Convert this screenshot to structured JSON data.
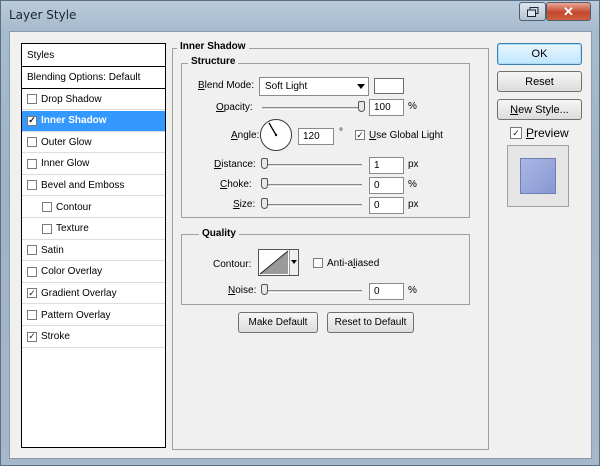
{
  "window": {
    "title": "Layer Style",
    "close_glyph": "✕",
    "restore_icon": "restore-icon"
  },
  "styles_list": {
    "header": "Styles",
    "blending": "Blending Options: Default",
    "items": [
      {
        "label": "Drop Shadow",
        "checked": false
      },
      {
        "label": "Inner Shadow",
        "checked": true,
        "selected": true
      },
      {
        "label": "Outer Glow",
        "checked": false
      },
      {
        "label": "Inner Glow",
        "checked": false
      },
      {
        "label": "Bevel and Emboss",
        "checked": false
      },
      {
        "label": "Contour",
        "checked": false,
        "sub": true
      },
      {
        "label": "Texture",
        "checked": false,
        "sub": true
      },
      {
        "label": "Satin",
        "checked": false
      },
      {
        "label": "Color Overlay",
        "checked": false
      },
      {
        "label": "Gradient Overlay",
        "checked": true
      },
      {
        "label": "Pattern Overlay",
        "checked": false
      },
      {
        "label": "Stroke",
        "checked": true
      }
    ]
  },
  "panel": {
    "title": "Inner Shadow",
    "structure": {
      "title": "Structure",
      "blend_mode_label": "Blend Mode:",
      "blend_mode_value": "Soft Light",
      "blend_color": "#ffffff",
      "opacity_label": "Opacity:",
      "opacity_value": "100",
      "opacity_unit": "%",
      "opacity_fraction": 1.0,
      "angle_label": "Angle:",
      "angle_value": "120",
      "angle_unit": "°",
      "angle_deg": 120,
      "global_light_label": "Use Global Light",
      "global_light_checked": true,
      "distance_label": "Distance:",
      "distance_value": "1",
      "distance_unit": "px",
      "choke_label": "Choke:",
      "choke_value": "0",
      "choke_unit": "%",
      "size_label": "Size:",
      "size_value": "0",
      "size_unit": "px"
    },
    "quality": {
      "title": "Quality",
      "contour_label": "Contour:",
      "anti_aliased_label": "Anti-aliased",
      "anti_aliased_checked": false,
      "noise_label": "Noise:",
      "noise_value": "0",
      "noise_unit": "%"
    },
    "make_default": "Make Default",
    "reset_default": "Reset to Default"
  },
  "actions": {
    "ok": "OK",
    "reset": "Reset",
    "new_style": "New Style...",
    "preview_label": "Preview",
    "preview_checked": true
  }
}
